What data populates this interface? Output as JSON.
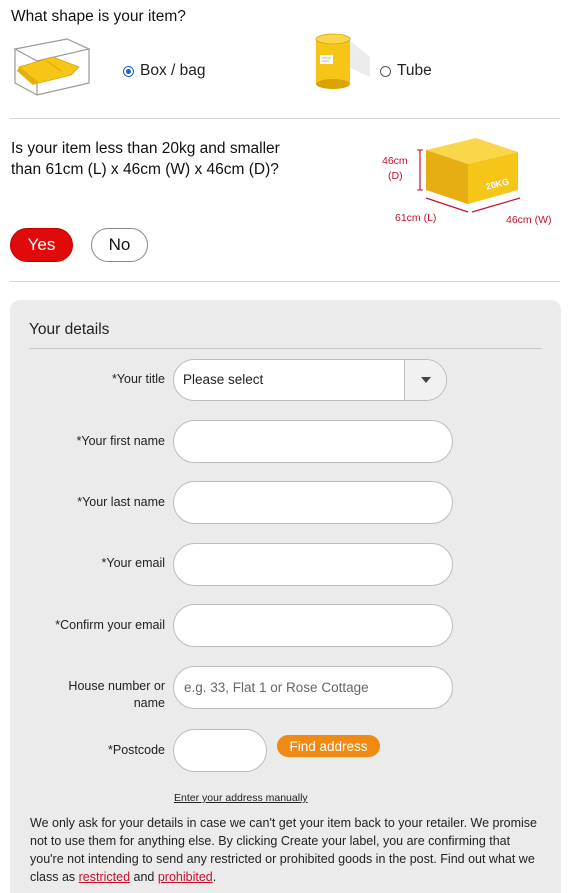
{
  "shape_section": {
    "question": "What shape is your item?",
    "options": [
      {
        "label": "Box / bag",
        "selected": true,
        "icon": "box-bag-icon"
      },
      {
        "label": "Tube",
        "selected": false,
        "icon": "tube-icon"
      }
    ]
  },
  "size_section": {
    "question_line1": "Is your item less than 20kg and smaller",
    "question_line2": "than 61cm (L) x 46cm (W) x 46cm (D)?",
    "diagram": {
      "depth_label_1": "46cm",
      "depth_label_2": "(D)",
      "length_label": "61cm (L)",
      "width_label": "46cm (W)",
      "weight_label": "20KG"
    },
    "yes_label": "Yes",
    "no_label": "No",
    "selected": "Yes"
  },
  "details": {
    "title": "Your details",
    "fields": {
      "title_label": "*Your title",
      "title_value": "Please select",
      "first_name_label": "*Your first name",
      "last_name_label": "*Your last name",
      "email_label": "*Your email",
      "confirm_email_label": "*Confirm your email",
      "house_label_1": "House number or",
      "house_label_2": "name",
      "house_placeholder": "e.g. 33, Flat 1 or Rose Cottage",
      "postcode_label": "*Postcode"
    },
    "find_address_label": "Find address",
    "manual_link": "Enter your address manually",
    "disclaimer": {
      "text": "We only ask for your details in case we can't get your item back to your retailer. We promise not to use them for anything else. By clicking Create your label, you are confirming that you're not intending to send any restricted or prohibited goods in the post. Find out what we class as ",
      "link_restricted": "restricted",
      "and_word": " and ",
      "link_prohibited": "prohibited",
      "end": "."
    }
  },
  "colors": {
    "brand_red": "#e00a0a",
    "find_orange": "#f08a12",
    "panel_grey": "#ebebeb",
    "parcel_yellow": "#f5c518",
    "link_red": "#c8102e"
  }
}
